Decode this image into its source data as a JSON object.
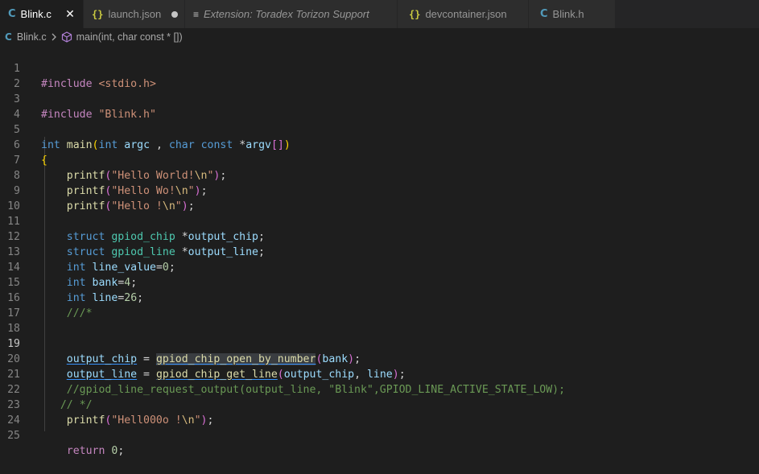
{
  "tabs": [
    {
      "icon": "C",
      "label": "Blink.c",
      "active": true,
      "close": "✕"
    },
    {
      "icon": "{}",
      "label": "launch.json",
      "modified": true
    },
    {
      "icon": "≡",
      "label": "Extension: Toradex Torizon Support"
    },
    {
      "icon": "{}",
      "label": "devcontainer.json"
    },
    {
      "icon": "C",
      "label": "Blink.h"
    }
  ],
  "breadcrumb": {
    "file_icon": "C",
    "file": "Blink.c",
    "symbol": "main(int, char const * [])"
  },
  "editor": {
    "current_line": "19",
    "lines": [
      {
        "n": "1",
        "code": "#include <stdio.h>"
      },
      {
        "n": "2",
        "code": ""
      },
      {
        "n": "3",
        "code": "#include \"Blink.h\""
      },
      {
        "n": "4",
        "code": ""
      },
      {
        "n": "5",
        "code": "int main(int argc , char const *argv[])"
      },
      {
        "n": "6",
        "code": "{"
      },
      {
        "n": "7",
        "code": "    printf(\"Hello World!\\n\");"
      },
      {
        "n": "8",
        "code": "    printf(\"Hello Wo!\\n\");"
      },
      {
        "n": "9",
        "code": "    printf(\"Hello !\\n\");"
      },
      {
        "n": "10",
        "code": ""
      },
      {
        "n": "11",
        "code": "    struct gpiod_chip *output_chip;"
      },
      {
        "n": "12",
        "code": "    struct gpiod_line *output_line;"
      },
      {
        "n": "13",
        "code": "    int line_value=0;"
      },
      {
        "n": "14",
        "code": "    int bank=4;"
      },
      {
        "n": "15",
        "code": "    int line=26;"
      },
      {
        "n": "16",
        "code": "    ///*"
      },
      {
        "n": "17",
        "code": ""
      },
      {
        "n": "18",
        "code": ""
      },
      {
        "n": "19",
        "code": "    output_chip = gpiod_chip_open_by_number(bank);"
      },
      {
        "n": "20",
        "code": "    output_line = gpiod_chip_get_line(output_chip, line);"
      },
      {
        "n": "21",
        "code": "    //gpiod_line_request_output(output_line, \"Blink\",GPIOD_LINE_ACTIVE_STATE_LOW);"
      },
      {
        "n": "22",
        "code": "   // */"
      },
      {
        "n": "23",
        "code": "    printf(\"Hell000o !\\n\");"
      },
      {
        "n": "24",
        "code": ""
      },
      {
        "n": "25",
        "code": "    return 0;"
      }
    ]
  },
  "colors": {
    "background": "#1e1e1e",
    "tab_bar": "#252526",
    "keyword": "#569cd6",
    "function": "#dcdcaa",
    "string": "#ce9178",
    "variable": "#9cdcfe",
    "type": "#4ec9b0",
    "number": "#b5cea8",
    "comment": "#6a9955",
    "c_file_icon": "#519aba",
    "json_icon": "#cbcb41"
  }
}
